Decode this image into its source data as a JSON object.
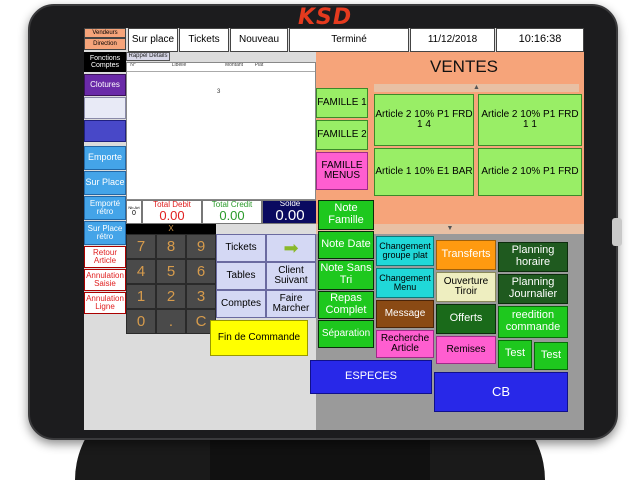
{
  "brand": "KSD",
  "topbar": {
    "vendeurs": "Vendeurs",
    "direction": "Direction",
    "sur_place": "Sur place",
    "tickets": "Tickets",
    "nouveau": "Nouveau",
    "status": "Terminé",
    "date": "11/12/2018",
    "time": "10:16:38"
  },
  "sidebar": {
    "fonctions_comptes": "Fonctions Comptes",
    "rappel_details": "Rappel Details",
    "clotures": "Clotures",
    "emporte": "Emporte",
    "sur_place": "Sur Place",
    "emporte_retro": "Emporté rétro",
    "sur_place_retro": "Sur Place rétro",
    "retour_article": "Retour Article",
    "annulation_saisie": "Annulation Saisie",
    "annulation_ligne": "Annulation Ligne"
  },
  "ticket": {
    "columns": [
      "N°",
      "Libelle",
      "Montant",
      "Plat"
    ],
    "marker": "3"
  },
  "totals": {
    "nb_art_label": "Nb.Art",
    "nb_art_value": "0",
    "total_debit_label": "Total Debit",
    "total_debit_value": "0.00",
    "total_credit_label": "Total Credit",
    "total_credit_value": "0.00",
    "solde_label": "Solde",
    "solde_value": "0.00"
  },
  "keypad": {
    "keys": [
      "7",
      "8",
      "9",
      "4",
      "5",
      "6",
      "1",
      "2",
      "3",
      "0",
      ".",
      "C"
    ],
    "x_key": "X"
  },
  "actions": {
    "tickets": "Tickets",
    "arrow": "➡",
    "tables": "Tables",
    "client_suivant": "Client Suivant",
    "comptes": "Comptes",
    "faire_marcher": "Faire Marcher",
    "fin_commande": "Fin de Commande"
  },
  "ventes": {
    "title": "VENTES",
    "scroll_up": "▲",
    "scroll_down": "▼",
    "families": [
      "FAMILLE 1",
      "FAMILLE 2",
      "FAMILLE MENUS"
    ],
    "articles": [
      "Article 2 10% P1 FRD 1 4",
      "Article 2 10% P1 FRD 1 1",
      "Article 1 10% E1 BAR",
      "Article 2 10% P1 FRD"
    ]
  },
  "functions": {
    "note_famille": "Note Famille",
    "note_date": "Note Date",
    "changement_groupe_plat": "Changement groupe plat",
    "transferts": "Transferts",
    "planning_horaire": "Planning horaire",
    "note_sans_tri": "Note Sans Tri",
    "changement_menu": "Changement Menu",
    "ouverture_tiroir": "Ouverture Tiroir",
    "planning_journalier": "Planning Journalier",
    "repas_complet": "Repas Complet",
    "message": "Message",
    "offerts": "Offerts",
    "reedition_commande": "reedition commande",
    "separation": "Séparation",
    "recherche_article": "Recherche Article",
    "remises": "Remises",
    "test1": "Test",
    "test2": "Test"
  },
  "payment": {
    "especes": "ESPECES",
    "cb": "CB"
  },
  "colors": {
    "orange_panel": "#f6a47a",
    "green_button": "#99ee66",
    "dark_green": "#1f5a1f",
    "blue_button": "#44a4e8",
    "pink_button": "#ff5ed0",
    "yellow_button": "#ffff00",
    "keypad": "#4a4a4a",
    "brand_red": "#e53a1e"
  }
}
